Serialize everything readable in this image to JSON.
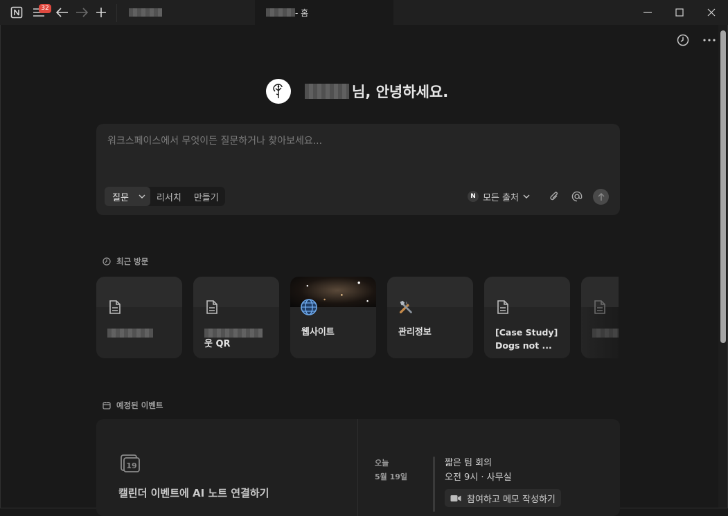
{
  "titlebar": {
    "notification_count": "32",
    "tabs": [
      {
        "label": ""
      },
      {
        "label": " - 홈"
      }
    ]
  },
  "greeting": {
    "suffix": "님, 안녕하세요."
  },
  "ask": {
    "placeholder": "워크스페이스에서 무엇이든 질문하거나 찾아보세요...",
    "modes": [
      "질문",
      "리서치",
      "만들기"
    ],
    "source_label": "모든 출처"
  },
  "recent": {
    "heading": "최근 방문",
    "cards": [
      {
        "title": "",
        "icon": "page-icon"
      },
      {
        "title": "웃 QR",
        "icon": "page-icon"
      },
      {
        "title": "웹사이트",
        "icon": "globe-icon"
      },
      {
        "title": "관리정보",
        "icon": "tools-icon"
      },
      {
        "title": "[Case Study] Dogs not ...",
        "icon": "page-icon"
      },
      {
        "title": "",
        "icon": "page-icon"
      }
    ]
  },
  "events": {
    "heading": "예정된 이벤트",
    "cta": "캘린더 이벤트에 AI 노트 연결하기",
    "day_label": "오늘",
    "date_label": "5월 19일",
    "event_title": "짧은 팀 회의",
    "event_time": "오전 9시 · 사무실",
    "join_label": "참여하고 메모 작성하기"
  },
  "colors": {
    "background": "#191919",
    "surface": "#252525",
    "badge": "#e0493f"
  }
}
